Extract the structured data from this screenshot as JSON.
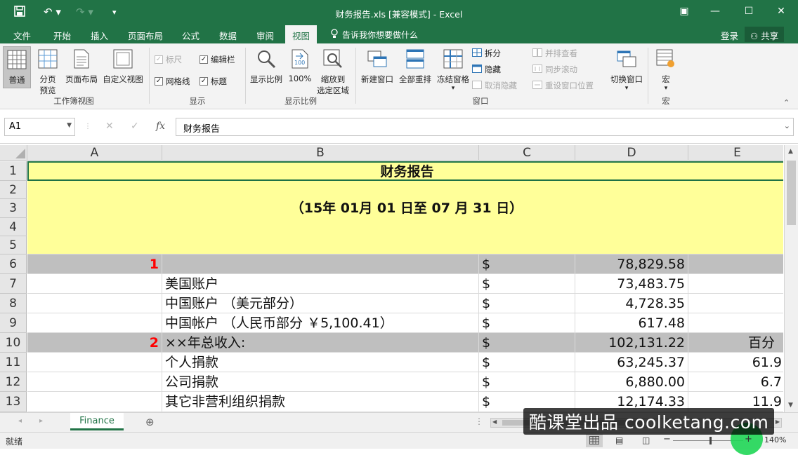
{
  "window": {
    "title": "财务报告.xls  [兼容模式] - Excel"
  },
  "tabs": [
    {
      "label": "文件"
    },
    {
      "label": "开始"
    },
    {
      "label": "插入"
    },
    {
      "label": "页面布局"
    },
    {
      "label": "公式"
    },
    {
      "label": "数据"
    },
    {
      "label": "审阅"
    },
    {
      "label": "视图"
    }
  ],
  "tell_me": "告诉我你想要做什么",
  "account": {
    "login": "登录",
    "share": "共享"
  },
  "ribbon": {
    "workbook_views": {
      "label": "工作簿视图",
      "normal": "普通",
      "page_break_a": "分页",
      "page_break_b": "预览",
      "page_layout": "页面布局",
      "custom_views": "自定义视图"
    },
    "show": {
      "label": "显示",
      "ruler": "标尺",
      "formula_bar": "编辑栏",
      "gridlines": "网格线",
      "headings": "标题"
    },
    "zoom": {
      "label": "显示比例",
      "zoom": "显示比例",
      "hundred": "100%",
      "zoom_sel_a": "缩放到",
      "zoom_sel_b": "选定区域"
    },
    "window": {
      "label": "窗口",
      "new_window": "新建窗口",
      "arrange_all": "全部重排",
      "freeze_panes": "冻结窗格",
      "split": "拆分",
      "hide": "隐藏",
      "unhide": "取消隐藏",
      "side_by_side": "并排查看",
      "sync_scroll": "同步滚动",
      "reset_pos": "重设窗口位置",
      "switch_windows": "切换窗口"
    },
    "macros": {
      "label": "宏",
      "macros": "宏"
    }
  },
  "formula_bar": {
    "name_box": "A1",
    "fx": "fx",
    "content": "财务报告"
  },
  "columns": [
    "A",
    "B",
    "C",
    "D",
    "E"
  ],
  "rows": [
    "1",
    "2",
    "3",
    "4",
    "5",
    "6",
    "7",
    "8",
    "9",
    "10",
    "11",
    "12",
    "13"
  ],
  "sheet": {
    "title": "财务报告",
    "date_range": "（15年  01月  01  日至  07  月  31  日）",
    "r6": {
      "a": "1",
      "c": "$",
      "d": "78,829.58"
    },
    "r7": {
      "b": "美国账户",
      "c": "$",
      "d": "73,483.75"
    },
    "r8": {
      "b": "中国账户 （美元部分）",
      "c": "$",
      "d": "4,728.35"
    },
    "r9": {
      "b": "中国帐户 （人民币部分 ￥5,100.41）",
      "c": "$",
      "d": "617.48"
    },
    "r10": {
      "a": "2",
      "b": "××年总收入:",
      "c": "$",
      "d": "102,131.22",
      "e": "百分"
    },
    "r11": {
      "b": "个人捐款",
      "c": "$",
      "d": "63,245.37",
      "e": "61.9"
    },
    "r12": {
      "b": "公司捐款",
      "c": "$",
      "d": "6,880.00",
      "e": "6.7"
    },
    "r13": {
      "b": "其它非营利组织捐款",
      "c": "$",
      "d": "12,174.33",
      "e": "11.9"
    }
  },
  "sheet_tab": "Finance",
  "status": {
    "ready": "就绪",
    "zoom": "140%"
  },
  "watermark": "酷课堂出品 coolketang.com",
  "colors": {
    "excel_green": "#217346",
    "header_yellow": "#ffff99",
    "band_gray": "#bfbfbf",
    "red_num": "#ff0000"
  }
}
